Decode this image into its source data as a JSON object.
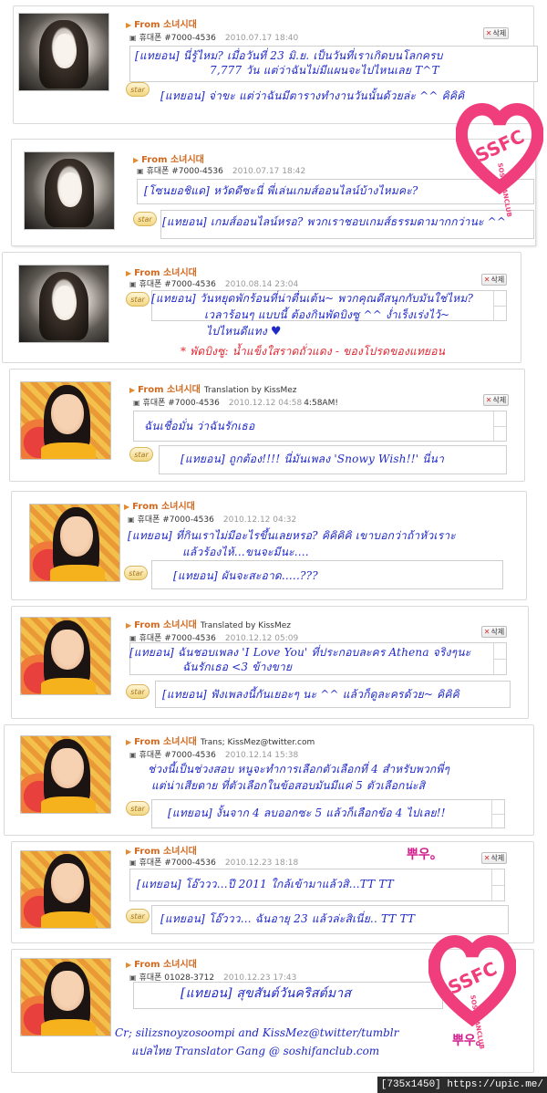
{
  "from_label": "From 소녀시대",
  "delete_label": "삭제",
  "star_label": "star",
  "posts": [
    {
      "from_extra": "",
      "phone": "휴대폰 #7000-4536",
      "date": "2010.07.17 18:40",
      "date_extra": "",
      "msg1": "[แทยอน] นี่รู้ไหม? เมื่อวันที่ 23 มิ.ย. เป็นวันที่เราเกิดบนโลกครบ",
      "msg1b": "7,777 วัน แต่ว่าฉันไม่มีแผนจะไปไหนเลย T^T",
      "msg2": "[แทยอน] จ่าขะ แต่ว่าฉันมีตารางทำงานวันนั้นด้วยล่ะ ^^ คิคิคิ",
      "note": ""
    },
    {
      "from_extra": "",
      "phone": "휴대폰 #7000-4536",
      "date": "2010.07.17 18:42",
      "date_extra": "",
      "msg1": "[โซนยอชิแด] หวัดดีซะนี่ พี่เล่นเกมส์ออนไลน์บ้างไหมคะ?",
      "msg1b": "",
      "msg2": "[แทยอน] เกมส์ออนไลน์หรอ? พวกเราชอบเกมส์ธรรมดามากกว่านะ ^^",
      "note": ""
    },
    {
      "from_extra": "",
      "phone": "휴대폰 #7000-4536",
      "date": "2010.08.14 23:04",
      "date_extra": "",
      "msg1": "[แทยอน] วันหยุดพักร้อนที่น่าตื่นเต้น~ พวกคุณดีสนุกกับมันใช่ไหม?",
      "msg1b": "เวลาร้อนๆ แบบนี้ ต้องกินพัดบิงซู ^^ ง่ำเร็งเร่งไว้~",
      "msg1c": "ไปไหนดีแทง",
      "msg2": "",
      "note": "* พัดบิงซู: น้ำแข็งใสราดถั่วแดง - ของโปรดของแทยอน"
    },
    {
      "from_extra": "Translation by KissMez",
      "phone": "휴대폰 #7000-4536",
      "date": "2010.12.12 04:58",
      "date_extra": "4:58AM!",
      "msg1": "ฉันเชื่อมั่น ว่าฉันรักเธอ",
      "msg1b": "",
      "msg2": "[แทยอน] ถูกต้อง!!!! นี่มันเพลง 'Snowy Wish!!' นี่นา",
      "note": ""
    },
    {
      "from_extra": "",
      "phone": "휴대폰 #7000-4536",
      "date": "2010.12.12 04:32",
      "date_extra": "",
      "msg1": "[แทยอน] ที่กินเราไม่มีอะไรขึ้นเลยหรอ? คิคิคิคิ เขาบอกว่าถ้าหัวเราะ",
      "msg1b": "แล้วร้องไห้...ขนจะมีนะ....",
      "msg2": "[แทยอน] ผันจะสะอาด.....???",
      "note": ""
    },
    {
      "from_extra": "Translated by KissMez",
      "phone": "휴대폰 #7000-4536",
      "date": "2010.12.12 05:09",
      "date_extra": "",
      "msg1": "[แทยอน] ฉันชอบเพลง 'I Love You' ที่ประกอบละคร Athena จริงๆนะ",
      "msg1b": "ฉันรักเธอ <3 ข้างขาย",
      "msg2": "[แทยอน] ฟังเพลงนี้กันเยอะๆ นะ ^^ แล้วก็ดูละครด้วย~ คิคิคิ",
      "note": ""
    },
    {
      "from_extra": "Trans; KissMez@twitter.com",
      "phone": "휴대폰 #7000-4536",
      "date": "2010.12.14 15:38",
      "date_extra": "",
      "msg1": "ช่วงนี้เป็นช่วงสอบ หนูจะทำการเลือกตัวเลือกที่ 4 สำหรับพวกพี่ๆ",
      "msg1b": "แต่น่าเสียดาย ที่ตัวเลือกในข้อสอบมันมีแค่ 5 ตัวเลือกน่ะสิ",
      "msg2": "[แทยอน] งั้นจาก 4 ลบออกซะ 5 แล้วก็เลือกข้อ 4 ไปเลย!!",
      "note": ""
    },
    {
      "from_extra": "",
      "phone": "휴대폰 #7000-4536",
      "date": "2010.12.23 18:18",
      "date_extra": "",
      "msg1": "[แทยอน] โอ๊ววว...ปี 2011 ใกล้เข้ามาแล้วสิ...TT TT",
      "msg1b": "",
      "msg2": "[แทยอน] โอ๊ววว... ฉันอายุ 23 แล้วล่ะสิเนี่ย.. TT TT",
      "note": ""
    },
    {
      "from_extra": "",
      "phone": "휴대폰 01028-3712",
      "date": "2010.12.23 17:43",
      "date_extra": "",
      "msg1": "[แทยอน] สุขสันต์วันคริสต์มาส",
      "msg1b": "",
      "msg2": "",
      "note": ""
    }
  ],
  "stamp": "뿌우。",
  "logo": {
    "main": "SSFC",
    "sub": "SOSHIFANCLUB"
  },
  "credits": {
    "line1": "Cr; silizsnoyzosoompi and KissMez@twitter/tumblr",
    "line2": "แปลไทย Translator Gang @ soshifanclub.com"
  },
  "footer": "[735x1450] https://upic.me/",
  "colors": {
    "thai_text": "#1f29c6",
    "note_red": "#e0252f",
    "from_orange": "#d2691e",
    "logo_pink": "#ef3e7b"
  }
}
